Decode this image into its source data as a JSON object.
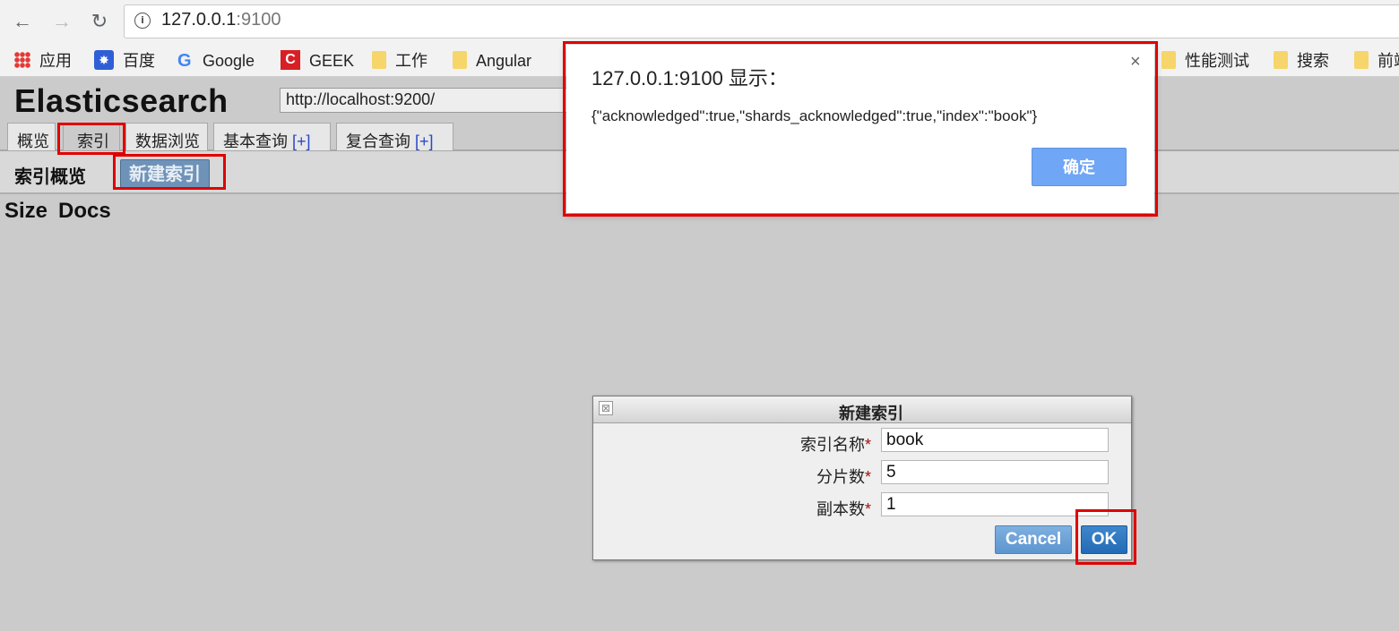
{
  "browser": {
    "url_host": "127.0.0.1",
    "url_port": ":9100",
    "bookmarks": [
      {
        "label": "应用",
        "icon": "apps-grid-icon"
      },
      {
        "label": "百度",
        "icon": "baidu-icon"
      },
      {
        "label": "Google",
        "icon": "google-icon"
      },
      {
        "label": "GEEK",
        "icon": "geek-icon"
      },
      {
        "label": "工作",
        "icon": "folder-icon"
      },
      {
        "label": "Angular",
        "icon": "folder-icon"
      },
      {
        "label": "性能测试",
        "icon": "folder-icon"
      },
      {
        "label": "搜索",
        "icon": "folder-icon"
      },
      {
        "label": "前端",
        "icon": "folder-icon"
      }
    ]
  },
  "app": {
    "title": "Elasticsearch",
    "cluster_url": "http://localhost:9200/",
    "tabs": [
      {
        "label": "概览"
      },
      {
        "label": "索引"
      },
      {
        "label": "数据浏览"
      },
      {
        "label": "基本查询",
        "plus": "[+]"
      },
      {
        "label": "复合查询",
        "plus": "[+]"
      }
    ],
    "subheader": {
      "title": "索引概览",
      "new_index_button": "新建索引"
    },
    "columns": {
      "size": "Size",
      "docs": "Docs"
    }
  },
  "alert": {
    "title": "127.0.0.1:9100 显示：",
    "message": "{\"acknowledged\":true,\"shards_acknowledged\":true,\"index\":\"book\"}",
    "close": "×",
    "ok_label": "确定"
  },
  "create_dialog": {
    "title": "新建索引",
    "fields": [
      {
        "label": "索引名称",
        "required": "*",
        "value": "book"
      },
      {
        "label": "分片数",
        "required": "*",
        "value": "5"
      },
      {
        "label": "副本数",
        "required": "*",
        "value": "1"
      }
    ],
    "cancel_label": "Cancel",
    "ok_label": "OK"
  },
  "colors": {
    "highlight": "#e00000",
    "page_bg": "#cbcbcb",
    "alert_ok": "#6fa6f5"
  }
}
